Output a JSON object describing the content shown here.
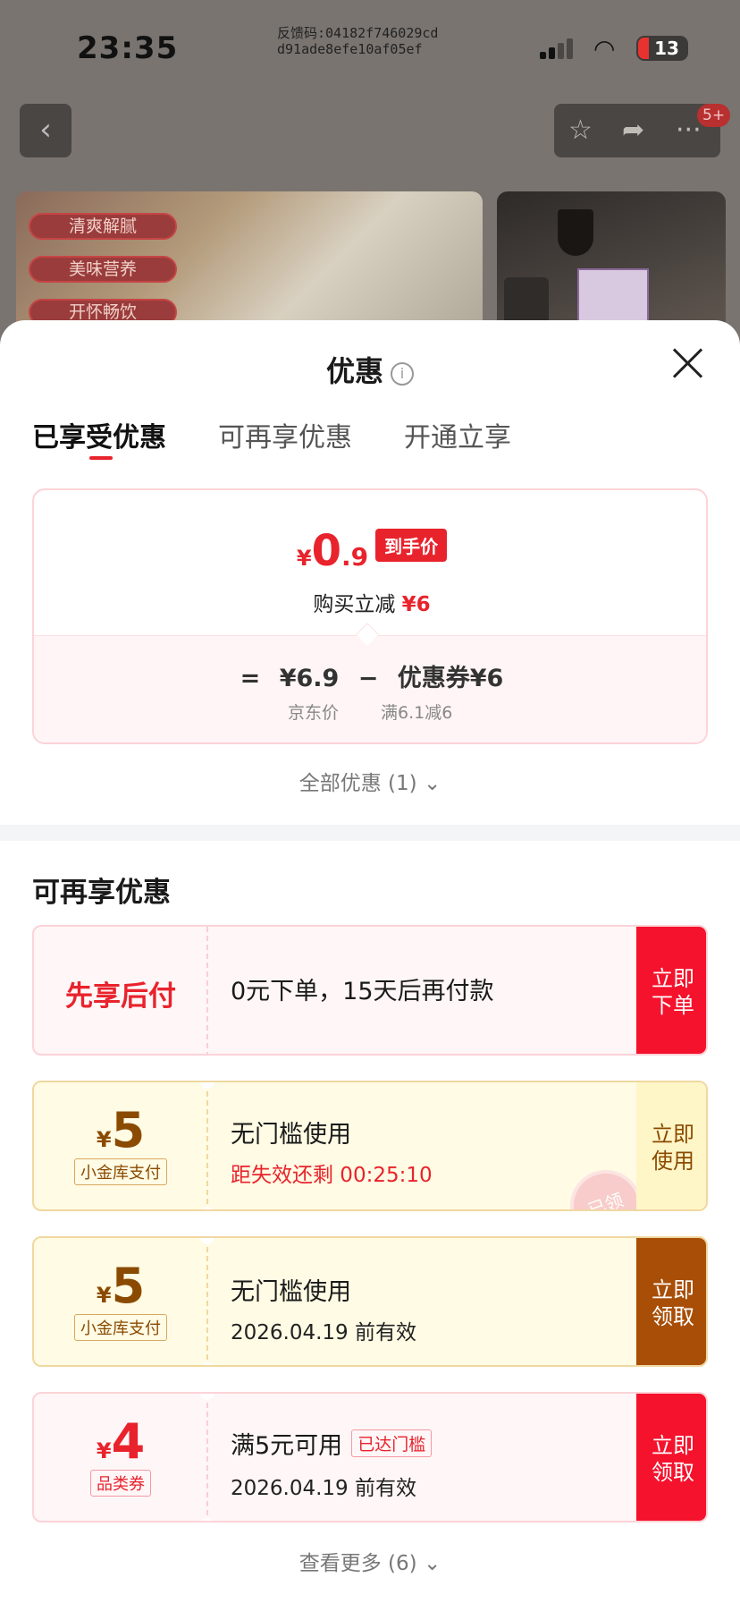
{
  "status_bar": {
    "time": "23:35",
    "feedback_line1": "反馈码:04182f746029cd",
    "feedback_line2": "d91ade8efe10af05ef",
    "battery": "13"
  },
  "background": {
    "tags": [
      "清爽解腻",
      "美味营养",
      "开怀畅饮"
    ],
    "message_badge": "5+"
  },
  "sheet": {
    "title": "优惠",
    "tabs": [
      {
        "label": "已享受优惠",
        "active": true
      },
      {
        "label": "可再享优惠",
        "active": false
      },
      {
        "label": "开通立享",
        "active": false
      }
    ],
    "price": {
      "yen": "¥",
      "int": "0",
      "dec": ".9",
      "tag": "到手价",
      "sub_prefix": "购买立减",
      "sub_value": "¥6",
      "eq": "=",
      "jd_price": "¥6.9",
      "minus": "−",
      "coupon": "优惠券¥6",
      "jd_label": "京东价",
      "coupon_rule": "满6.1减6"
    },
    "all_offers": "全部优惠 (1)",
    "section_title": "可再享优惠",
    "cards": [
      {
        "left_label": "先享后付",
        "title": "0元下单，15天后再付款",
        "action_line1": "立即",
        "action_line2": "下单"
      },
      {
        "yen": "¥",
        "amount": "5",
        "tag": "小金库支付",
        "title": "无门槛使用",
        "sub": "距失效还剩 00:25:10",
        "stamp": "已领",
        "action_line1": "立即",
        "action_line2": "使用"
      },
      {
        "yen": "¥",
        "amount": "5",
        "tag": "小金库支付",
        "title": "无门槛使用",
        "sub": "2026.04.19 前有效",
        "action_line1": "立即",
        "action_line2": "领取"
      },
      {
        "yen": "¥",
        "amount": "4",
        "tag": "品类券",
        "title": "满5元可用",
        "threshold": "已达门槛",
        "sub": "2026.04.19 前有效",
        "action_line1": "立即",
        "action_line2": "领取"
      }
    ],
    "see_more": "查看更多 (6)"
  },
  "colors": {
    "accent_red": "#e8232c",
    "gold_text": "#8a4a00",
    "brown_button": "#a84e06"
  }
}
